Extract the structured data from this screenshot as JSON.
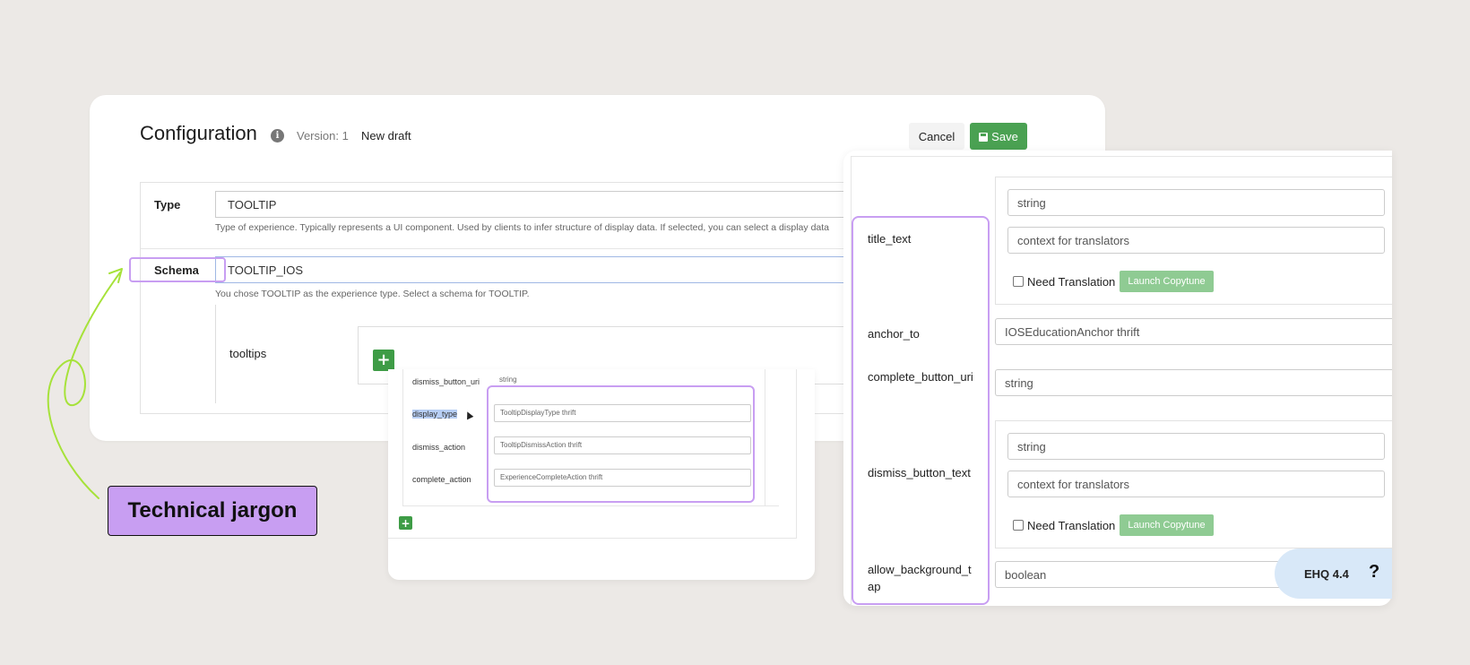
{
  "configuration": {
    "title": "Configuration",
    "version_label": "Version: 1",
    "draft_label": "New draft",
    "cancel_label": "Cancel",
    "save_label": "Save",
    "type": {
      "label": "Type",
      "value": "TOOLTIP",
      "help": "Type of experience. Typically represents a UI component. Used by clients to infer structure of display data. If selected, you can select a display data"
    },
    "schema": {
      "label": "Schema",
      "value": "TOOLTIP_IOS",
      "help": "You chose TOOLTIP as the experience type. Select a schema for TOOLTIP."
    },
    "tooltips_label": "tooltips",
    "add_button": "+"
  },
  "tooltip_fields": {
    "rows": [
      {
        "label": "dismiss_button_uri",
        "value": "string"
      },
      {
        "label": "display_type",
        "value": "TooltipDisplayType thrift"
      },
      {
        "label": "dismiss_action",
        "value": "TooltipDismissAction thrift"
      },
      {
        "label": "complete_action",
        "value": "ExperienceCompleteAction thrift"
      }
    ],
    "add_button": "+"
  },
  "detail_panel": {
    "title_text": {
      "label": "title_text",
      "value": "string",
      "context": "context for translators",
      "need_translation": "Need Translation",
      "copytune": "Launch Copytune"
    },
    "anchor_to": {
      "label": "anchor_to",
      "value": "IOSEducationAnchor thrift"
    },
    "complete_button_uri": {
      "label": "complete_button_uri",
      "value": "string"
    },
    "dismiss_button_text": {
      "label": "dismiss_button_text",
      "value": "string",
      "context": "context for translators",
      "need_translation": "Need Translation",
      "copytune": "Launch Copytune"
    },
    "allow_background_tap": {
      "label": "allow_background_tap",
      "value": "boolean"
    }
  },
  "badge": {
    "version": "EHQ 4.4",
    "help": "?"
  },
  "annotation": {
    "label": "Technical jargon"
  },
  "colors": {
    "background": "#ece9e6",
    "highlight": "#c89ef2",
    "save_green": "#4aa152",
    "copytune_green": "#8fcb93",
    "badge_blue": "#d8e8f8",
    "arrow_green": "#a6e23a"
  }
}
